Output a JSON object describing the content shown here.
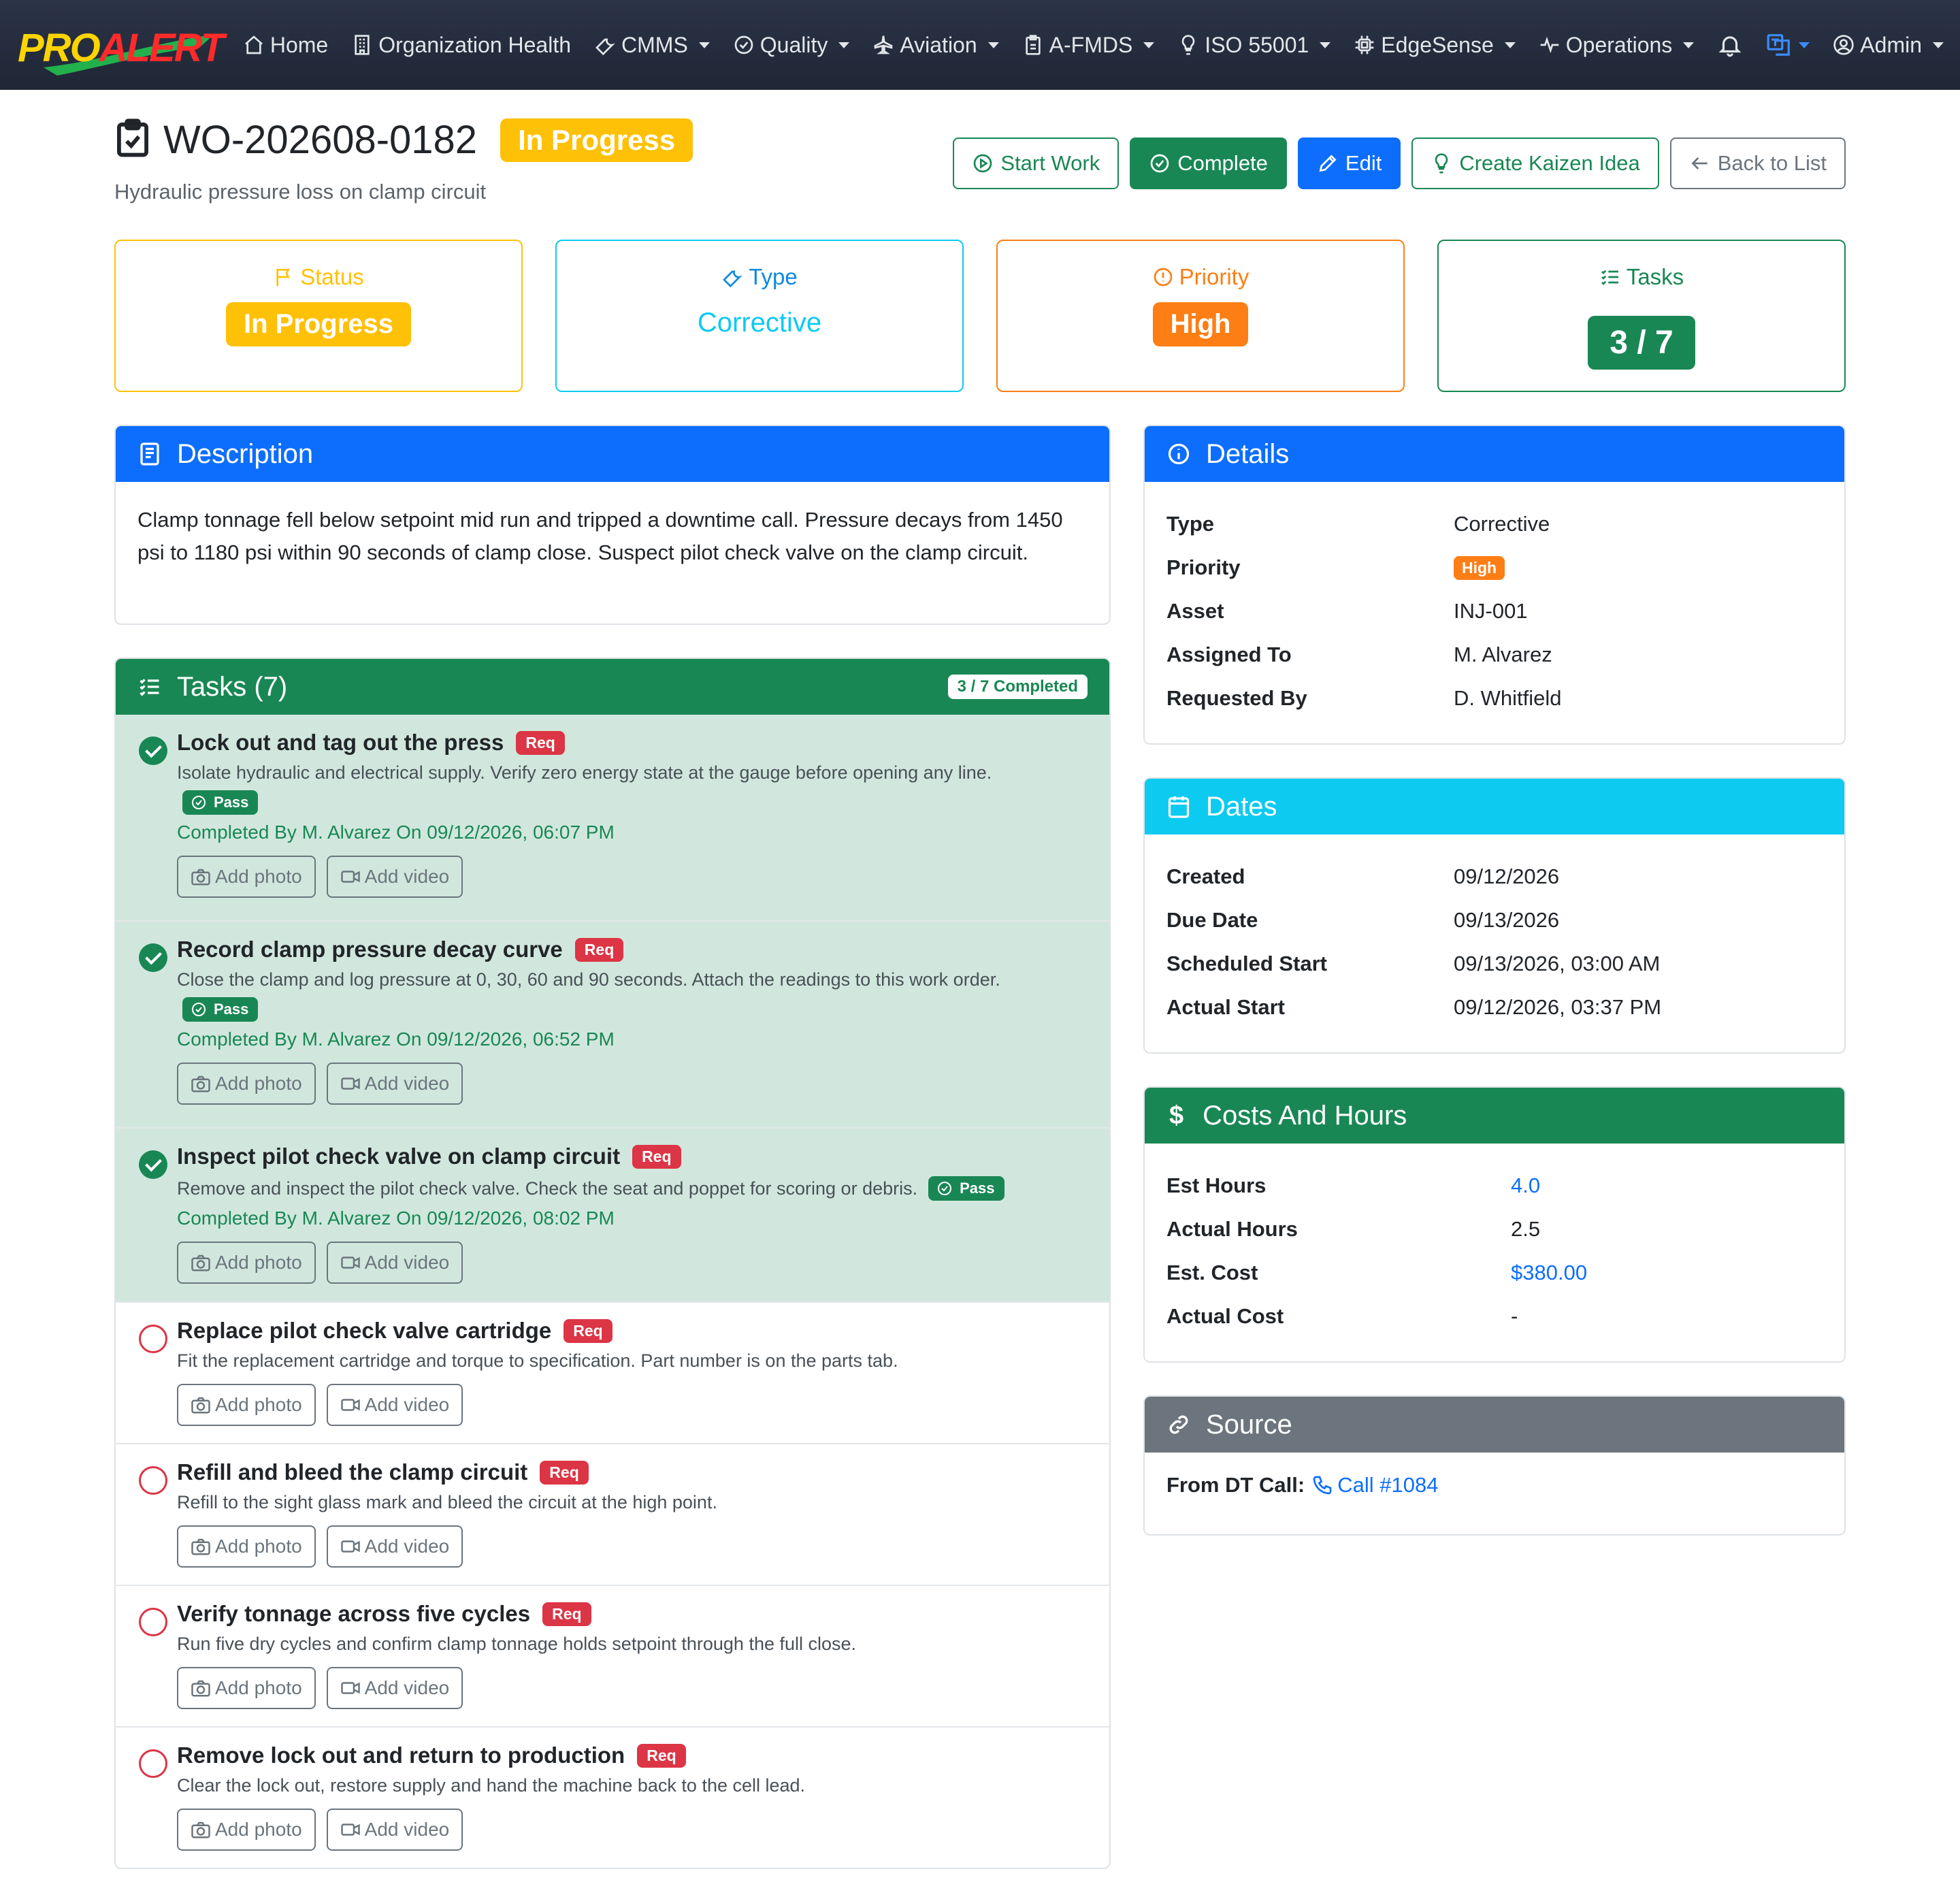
{
  "nav": {
    "logo": {
      "pro": "PRO",
      "alert": "ALERT"
    },
    "items": [
      {
        "label": "Home",
        "icon": "house-icon",
        "dropdown": false
      },
      {
        "label": "Organization Health",
        "icon": "building-icon",
        "dropdown": false
      },
      {
        "label": "CMMS",
        "icon": "wrench-icon",
        "dropdown": true
      },
      {
        "label": "Quality",
        "icon": "check-circle-icon",
        "dropdown": true
      },
      {
        "label": "Aviation",
        "icon": "airplane-icon",
        "dropdown": true
      },
      {
        "label": "A-FMDS",
        "icon": "clipboard-icon",
        "dropdown": true
      },
      {
        "label": "ISO 55001",
        "icon": "lightbulb-icon",
        "dropdown": true
      },
      {
        "label": "EdgeSense",
        "icon": "cpu-icon",
        "dropdown": true
      },
      {
        "label": "Operations",
        "icon": "activity-icon",
        "dropdown": true
      }
    ],
    "user": "Admin"
  },
  "work_order": {
    "number": "WO-202608-0182",
    "status": "In Progress",
    "subtitle": "Hydraulic pressure loss on clamp circuit"
  },
  "actions": {
    "start_work": "Start Work",
    "complete": "Complete",
    "edit": "Edit",
    "create_kaizen": "Create Kaizen Idea",
    "back_to_list": "Back to List"
  },
  "summary": {
    "status": {
      "label": "Status",
      "value": "In Progress"
    },
    "type": {
      "label": "Type",
      "value": "Corrective"
    },
    "priority": {
      "label": "Priority",
      "value": "High"
    },
    "tasks": {
      "label": "Tasks",
      "value": "3 / 7"
    }
  },
  "colors": {
    "warning": "#ffc107",
    "info": "#0dcaf0",
    "orange": "#fd7e14",
    "success": "#198754",
    "primary": "#0d6efd",
    "danger": "#dc3545",
    "secondary": "#6c757d"
  },
  "description": {
    "title": "Description",
    "text": "Clamp tonnage fell below setpoint mid run and tripped a downtime call. Pressure decays from 1450 psi to 1180 psi within 90 seconds of clamp close. Suspect pilot check valve on the clamp circuit."
  },
  "tasks": {
    "title": "Tasks (7)",
    "completed_label": "3 / 7 Completed",
    "req_label": "Req",
    "pass_label": "Pass",
    "add_photo": "Add photo",
    "add_video": "Add video",
    "items": [
      {
        "title": "Lock out and tag out the press",
        "desc": "Isolate hydraulic and electrical supply. Verify zero energy state at the gauge before opening any line.",
        "done": true,
        "completed_by": "Completed By M. Alvarez On 09/12/2026, 06:07 PM"
      },
      {
        "title": "Record clamp pressure decay curve",
        "desc": "Close the clamp and log pressure at 0, 30, 60 and 90 seconds. Attach the readings to this work order.",
        "done": true,
        "completed_by": "Completed By M. Alvarez On 09/12/2026, 06:52 PM"
      },
      {
        "title": "Inspect pilot check valve on clamp circuit",
        "desc": "Remove and inspect the pilot check valve. Check the seat and poppet for scoring or debris.",
        "done": true,
        "completed_by": "Completed By M. Alvarez On 09/12/2026, 08:02 PM"
      },
      {
        "title": "Replace pilot check valve cartridge",
        "desc": "Fit the replacement cartridge and torque to specification. Part number is on the parts tab.",
        "done": false
      },
      {
        "title": "Refill and bleed the clamp circuit",
        "desc": "Refill to the sight glass mark and bleed the circuit at the high point.",
        "done": false
      },
      {
        "title": "Verify tonnage across five cycles",
        "desc": "Run five dry cycles and confirm clamp tonnage holds setpoint through the full close.",
        "done": false
      },
      {
        "title": "Remove lock out and return to production",
        "desc": "Clear the lock out, restore supply and hand the machine back to the cell lead.",
        "done": false
      }
    ]
  },
  "details": {
    "title": "Details",
    "rows": [
      {
        "k": "Type",
        "v": "Corrective"
      },
      {
        "k": "Priority",
        "v": "High"
      },
      {
        "k": "Asset",
        "v": "INJ-001"
      },
      {
        "k": "Assigned To",
        "v": "M. Alvarez"
      },
      {
        "k": "Requested By",
        "v": "D. Whitfield"
      }
    ]
  },
  "dates": {
    "title": "Dates",
    "rows": [
      {
        "k": "Created",
        "v": "09/12/2026"
      },
      {
        "k": "Due Date",
        "v": "09/13/2026"
      },
      {
        "k": "Scheduled Start",
        "v": "09/13/2026, 03:00 AM"
      },
      {
        "k": "Actual Start",
        "v": "09/12/2026, 03:37 PM"
      }
    ]
  },
  "costs": {
    "title": "Costs And Hours",
    "rows": [
      {
        "k": "Est Hours",
        "v": "4.0"
      },
      {
        "k": "Actual Hours",
        "v": "2.5"
      },
      {
        "k": "Est. Cost",
        "v": "$380.00"
      },
      {
        "k": "Actual Cost",
        "v": "-"
      }
    ]
  },
  "source": {
    "title": "Source",
    "label": "From DT Call:",
    "call": "Call #1084"
  }
}
